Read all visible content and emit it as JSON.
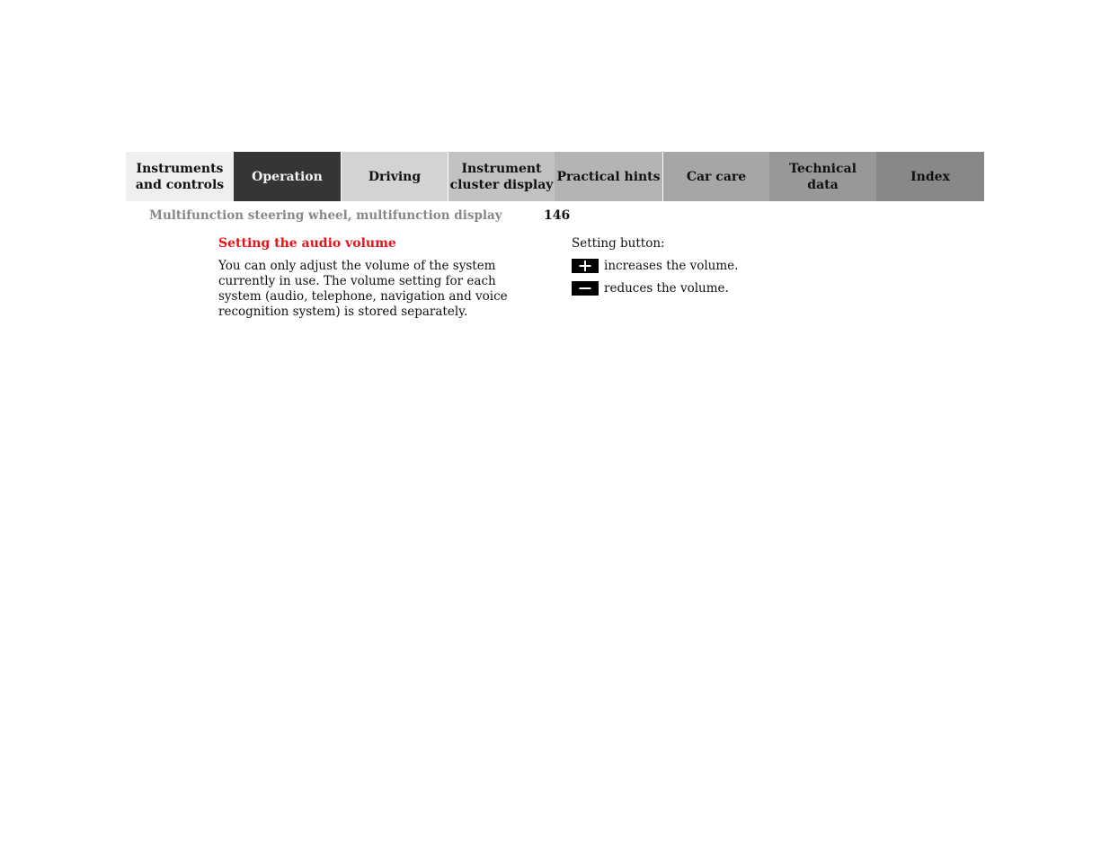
{
  "nav_tabs": [
    {
      "line1": "Instruments",
      "line2": "and controls"
    },
    {
      "line1": "Operation",
      "line2": ""
    },
    {
      "line1": "Driving",
      "line2": ""
    },
    {
      "line1": "Instrument",
      "line2": "cluster display"
    },
    {
      "line1": "Practical hints",
      "line2": ""
    },
    {
      "line1": "Car care",
      "line2": ""
    },
    {
      "line1": "Technical",
      "line2": "data"
    },
    {
      "line1": "Index",
      "line2": ""
    }
  ],
  "header": {
    "section_title": "Multifunction steering wheel, multifunction display",
    "page_number": "146"
  },
  "content": {
    "heading": "Setting the audio volume",
    "paragraph": "You can only adjust the volume of the system currently in use. The volume setting for each system (audio, telephone, navigation and voice recognition system) is stored separately.",
    "setting_label": "Setting button:",
    "buttons": [
      {
        "icon": "plus-icon",
        "text": "increases the volume."
      },
      {
        "icon": "minus-icon",
        "text": "reduces the volume."
      }
    ]
  },
  "colors": {
    "heading": "#e8121a",
    "active_tab": "#353535"
  }
}
